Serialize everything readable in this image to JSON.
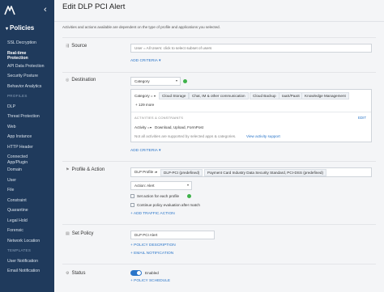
{
  "sidebar": {
    "title": "Policies",
    "items": [
      {
        "label": "SSL Decryption",
        "active": false
      },
      {
        "label": "Real-time Protection",
        "active": true
      },
      {
        "label": "API Data Protection",
        "active": false
      },
      {
        "label": "Security Posture",
        "active": false
      },
      {
        "label": "Behavior Analytics",
        "active": false
      }
    ],
    "profiles_section": "PROFILES",
    "profiles": [
      "DLP",
      "Threat Protection",
      "Web",
      "App Instance",
      "HTTP Header",
      "Connected App/Plugin",
      "Domain",
      "User",
      "File",
      "Constraint",
      "Quarantine",
      "Legal Hold",
      "Forensic",
      "Network Location"
    ],
    "templates_section": "TEMPLATES",
    "templates": [
      "User Notification",
      "Email Notification"
    ]
  },
  "page": {
    "title": "Edit DLP PCI Alert",
    "subtitle": "Activities and actions available are dependent on the type of profile and applications you selected."
  },
  "source": {
    "label": "Source",
    "placeholder": "User = All Users: click to select subset of users",
    "add_criteria": "ADD CRITERIA"
  },
  "destination": {
    "label": "Destination",
    "type_value": "Category",
    "category_label": "Category =",
    "chips": [
      "Cloud Storage",
      "Chat, IM & other communication",
      "Cloud Backup",
      "IaaS/PaaS",
      "Knowledge Management"
    ],
    "more": "+ 129 more",
    "activities_header": "ACTIVITIES & CONSTRAINTS",
    "edit": "EDIT",
    "activity_label": "Activity =",
    "activity_value": "Download, Upload, FormPost",
    "note": "Not all activities are supported by selected apps & categories.",
    "view_support": "View activity support",
    "add_criteria": "ADD CRITERIA"
  },
  "profile_action": {
    "label": "Profile & Action",
    "profile_label": "DLP Profile =",
    "profile_chips": [
      "DLP-PCI (predefined)",
      "Payment Card Industry Data Security Standard, PCI-DSS (predefined)"
    ],
    "action_value": "Action: Alert",
    "check_set_action": "Set action for each profile",
    "check_continue": "Continue policy evaluation after match",
    "add_traffic": "+ ADD TRAFFIC ACTION"
  },
  "set_policy": {
    "label": "Set Policy",
    "policy_name": "DLP PCI Alert",
    "policy_description": "+ POLICY DESCRIPTION",
    "email_notification": "+ EMAIL NOTIFICATION"
  },
  "status": {
    "label": "Status",
    "toggle_label": "Enabled",
    "policy_schedule": "+ POLICY SCHEDULE"
  },
  "colors": {
    "sidebar_bg": "#1f3a5c",
    "link": "#2a75c9",
    "green": "#3fb24a"
  }
}
